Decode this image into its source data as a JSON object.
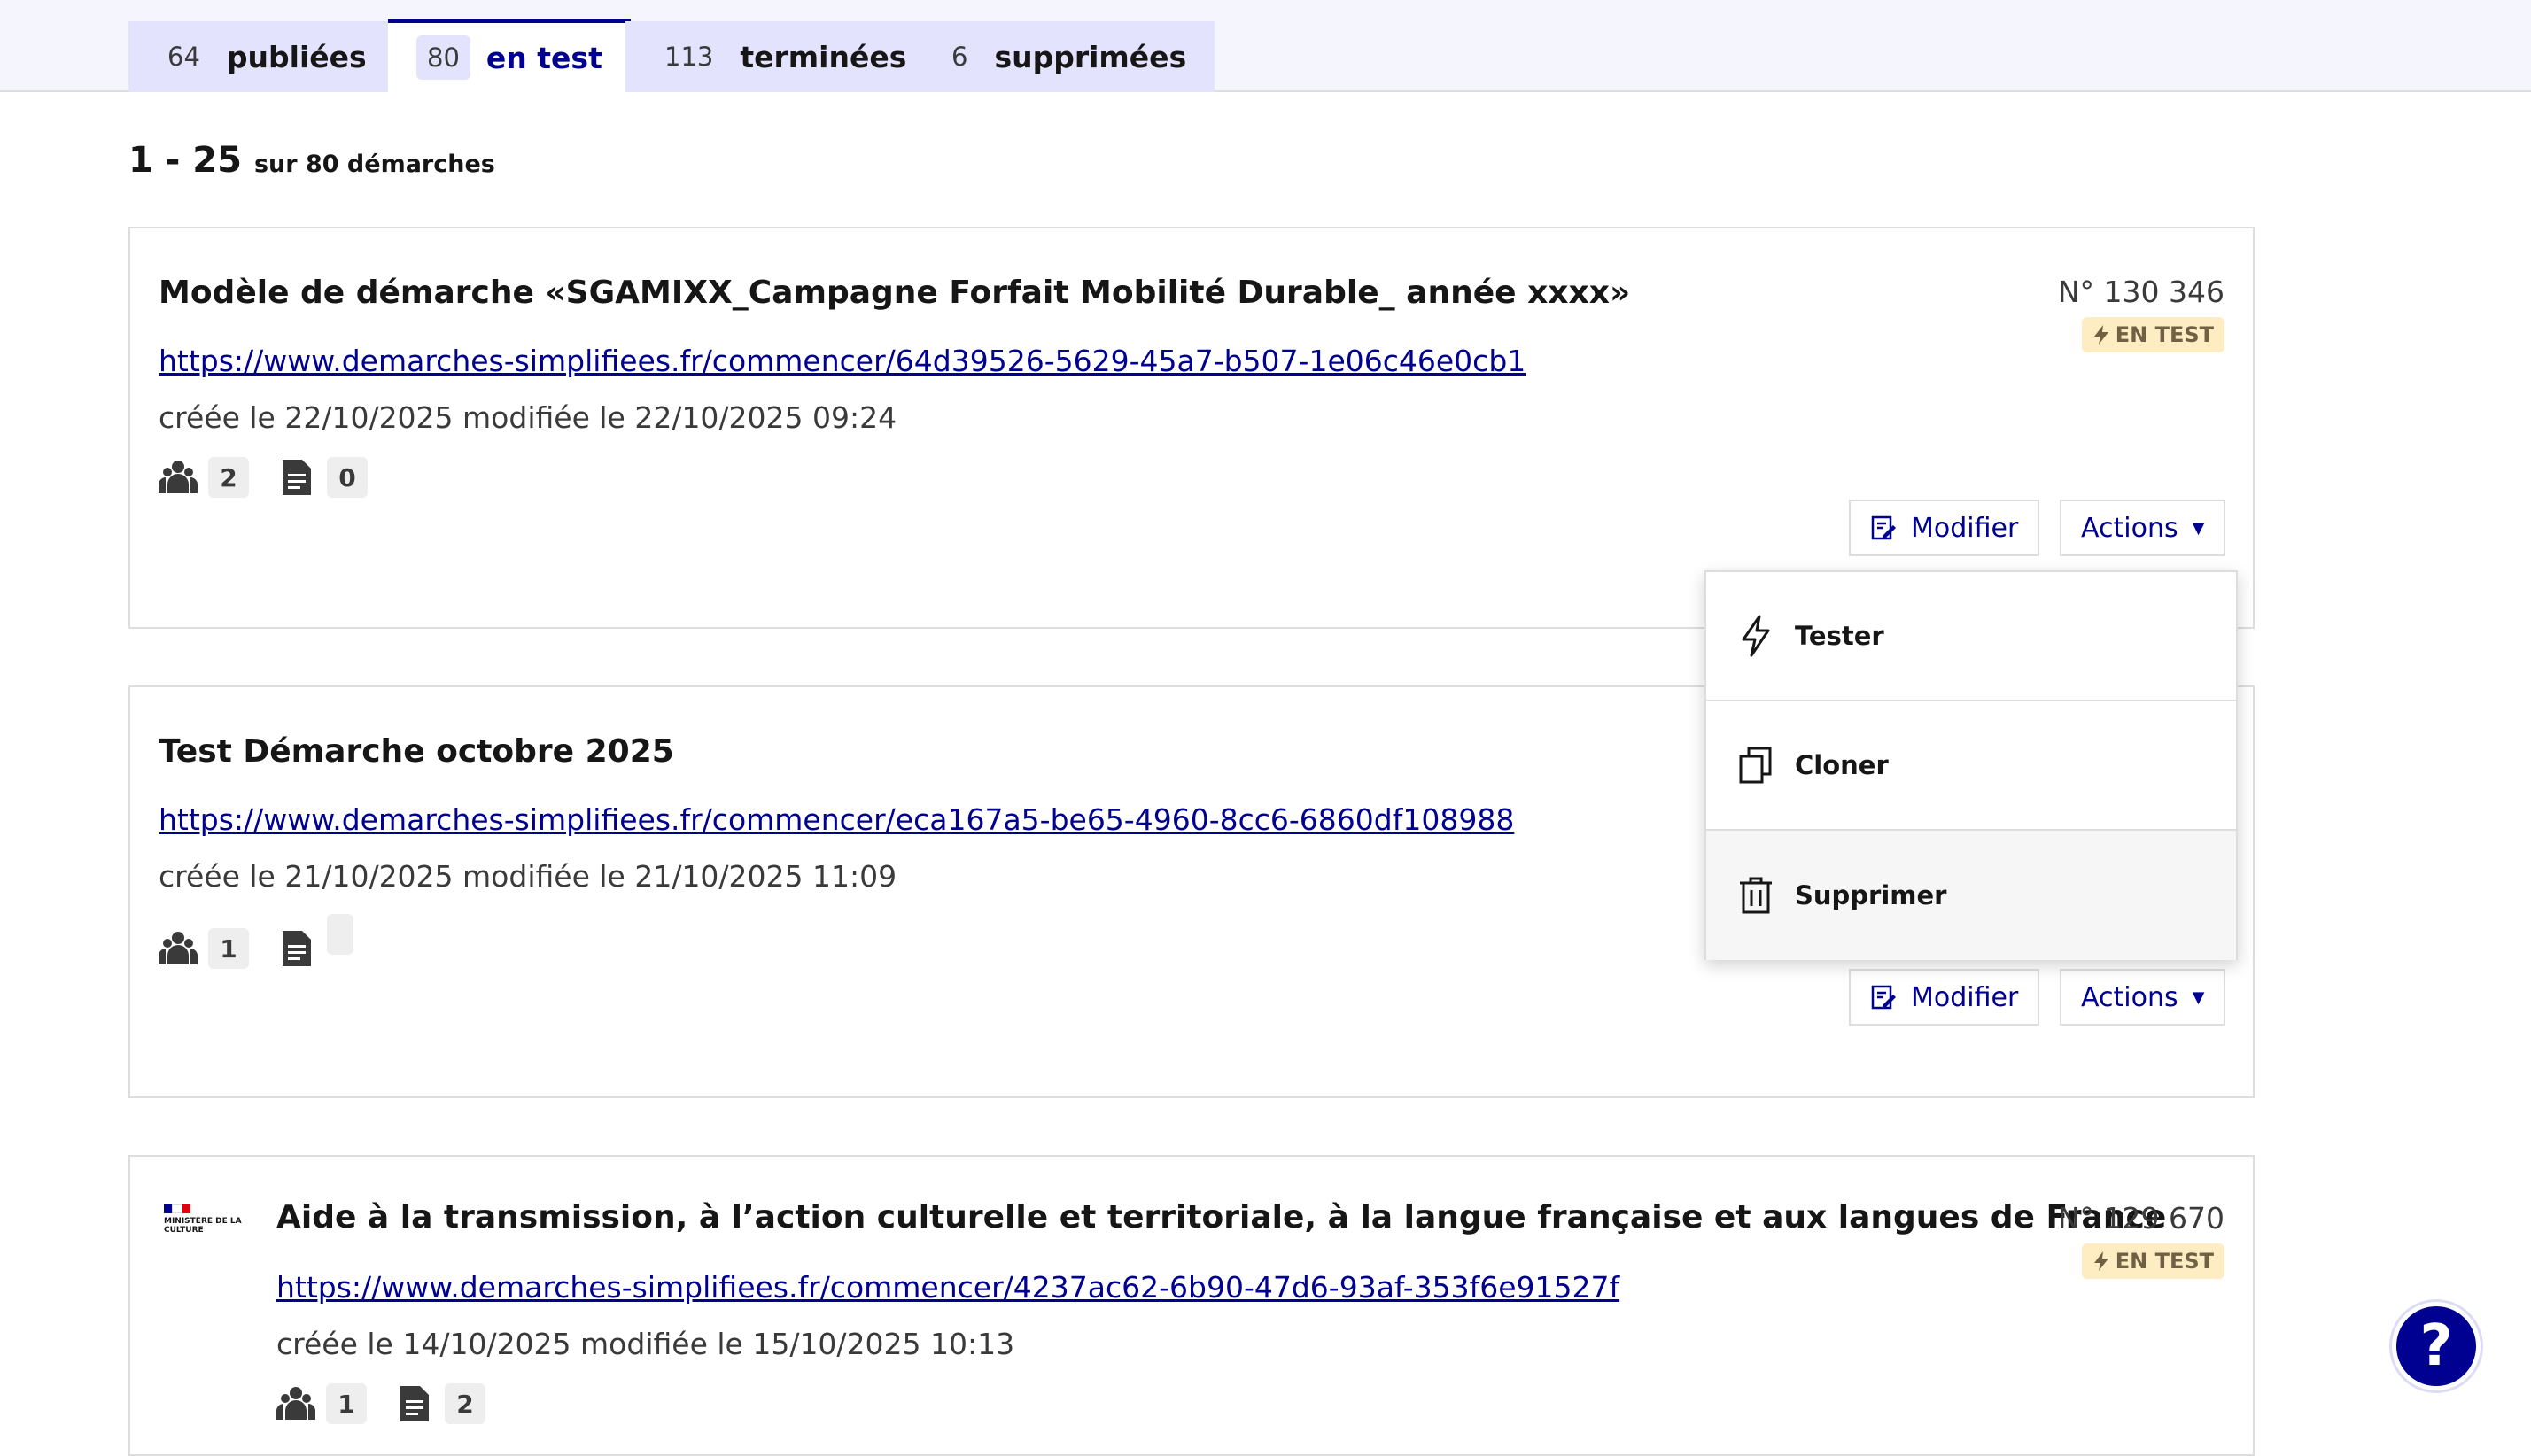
{
  "tabs": [
    {
      "count": "64",
      "label": "publiées"
    },
    {
      "count": "80",
      "label": "en test"
    },
    {
      "count": "113",
      "label": "terminées"
    },
    {
      "count": "6",
      "label": "supprimées"
    }
  ],
  "pager": {
    "range": "1 - 25",
    "total": "sur 80 démarches"
  },
  "cards": [
    {
      "title": "Modèle de démarche «SGAMIXX_Campagne Forfait Mobilité Durable_ année xxxx»",
      "link": "https://www.demarches-simplifiees.fr/commencer/64d39526-5629-45a7-b507-1e06c46e0cb1",
      "dates": "créée le 22/10/2025 modifiée le 22/10/2025 09:24",
      "number": "N° 130 346",
      "badge": "EN TEST",
      "admins": "2",
      "dossiers": "0",
      "modify": "Modifier",
      "actions": "Actions"
    },
    {
      "title": "Test Démarche octobre 2025",
      "link": "https://www.demarches-simplifiees.fr/commencer/eca167a5-be65-4960-8cc6-6860df108988",
      "dates": "créée le 21/10/2025 modifiée le 21/10/2025 11:09",
      "admins": "1",
      "dossiers": "",
      "modify": "Modifier",
      "actions": "Actions"
    },
    {
      "title": "Aide à la transmission, à l’action culturelle et territoriale, à la langue française et aux langues de France",
      "link": "https://www.demarches-simplifiees.fr/commencer/4237ac62-6b90-47d6-93af-353f6e91527f",
      "dates": "créée le 14/10/2025 modifiée le 15/10/2025 10:13",
      "number": "N° 129 670",
      "badge": "EN TEST",
      "admins": "1",
      "dossiers": "2",
      "logo": "MINISTÈRE DE LA CULTURE"
    }
  ],
  "menu": {
    "items": [
      "Tester",
      "Cloner",
      "Supprimer"
    ]
  },
  "help": {
    "label": "?"
  },
  "colors": {
    "primary": "#000091",
    "badge_bg": "#feecc2",
    "badge_fg": "#716043"
  }
}
